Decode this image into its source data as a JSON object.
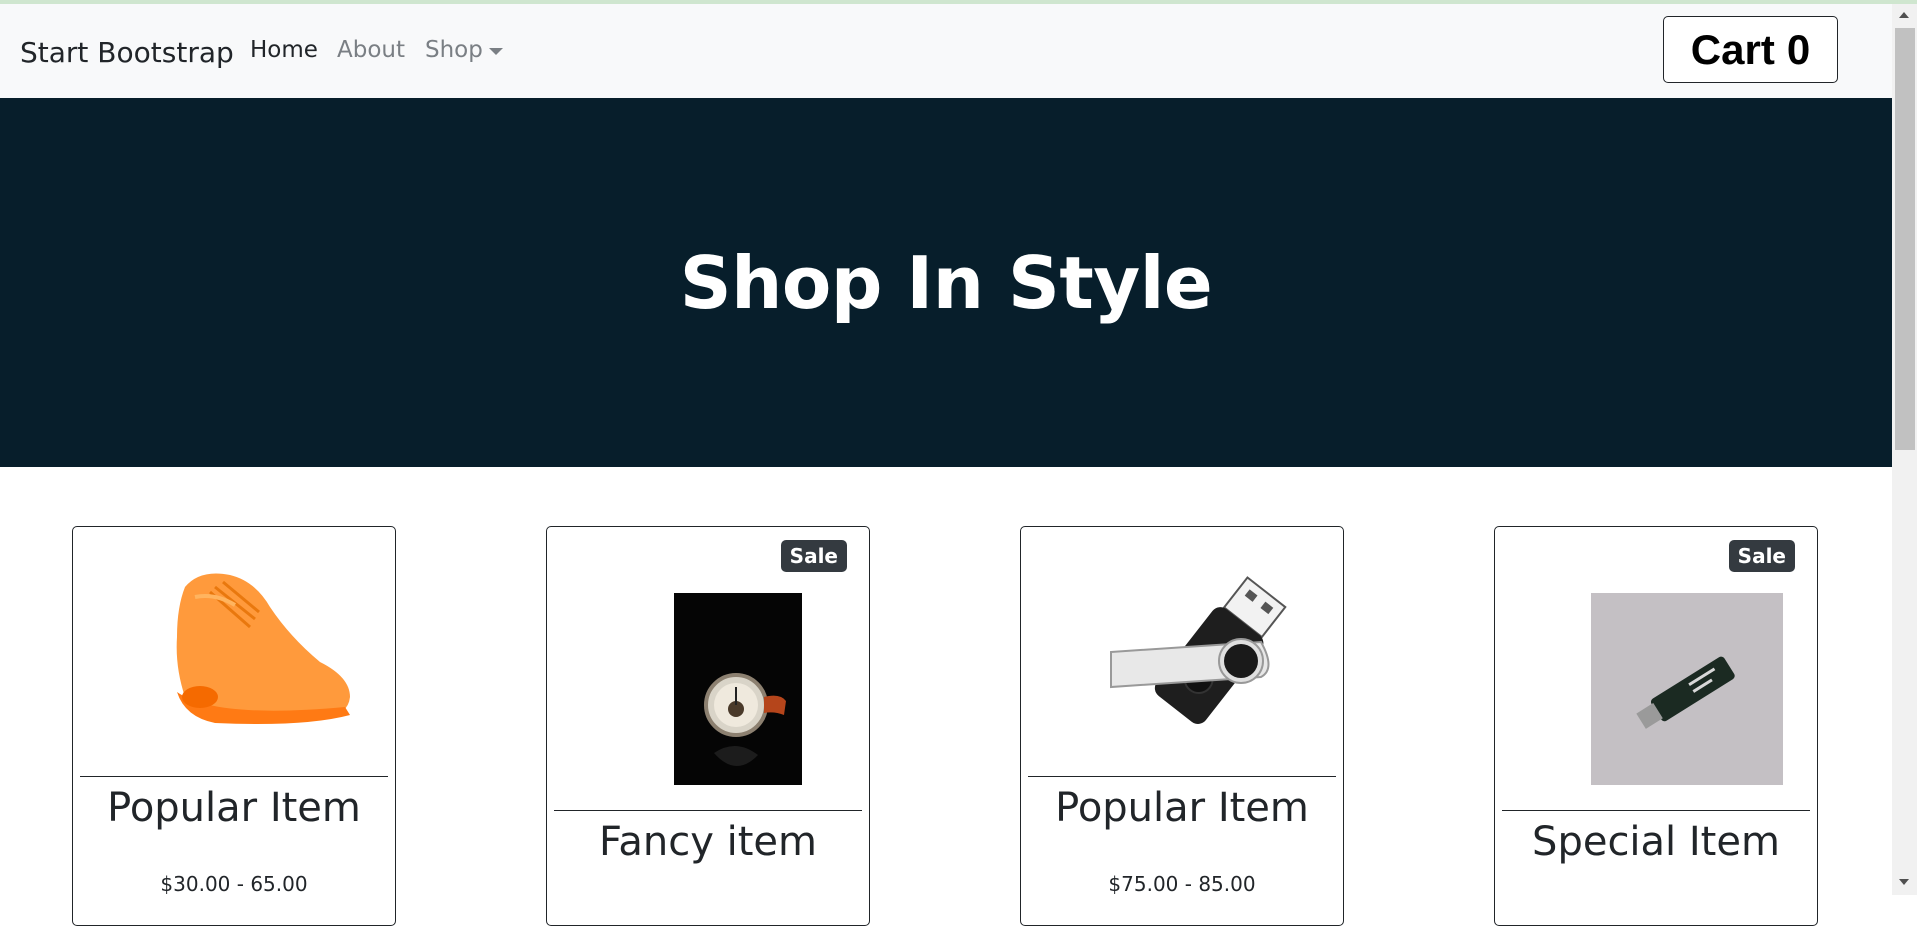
{
  "nav": {
    "brand": "Start Bootstrap",
    "links": [
      {
        "label": "Home"
      },
      {
        "label": "About"
      },
      {
        "label": "Shop"
      }
    ],
    "cart": {
      "label": "Cart",
      "count": "0"
    }
  },
  "hero": {
    "title": "Shop In Style"
  },
  "products": [
    {
      "name": "Popular Item",
      "price": "$30.00 - 65.00",
      "badge": "",
      "image": "orange-sneaker"
    },
    {
      "name": "Fancy item",
      "price": "",
      "badge": "Sale",
      "image": "wristwatch"
    },
    {
      "name": "Popular Item",
      "price": "$75.00 - 85.00",
      "badge": "",
      "image": "usb-flash-drive"
    },
    {
      "name": "Special Item",
      "price": "",
      "badge": "Sale",
      "image": "usb-stick"
    }
  ],
  "colors": {
    "hero_bg": "#071e2b",
    "navbar_bg": "#f8f9fa",
    "badge_bg": "#343a40"
  }
}
